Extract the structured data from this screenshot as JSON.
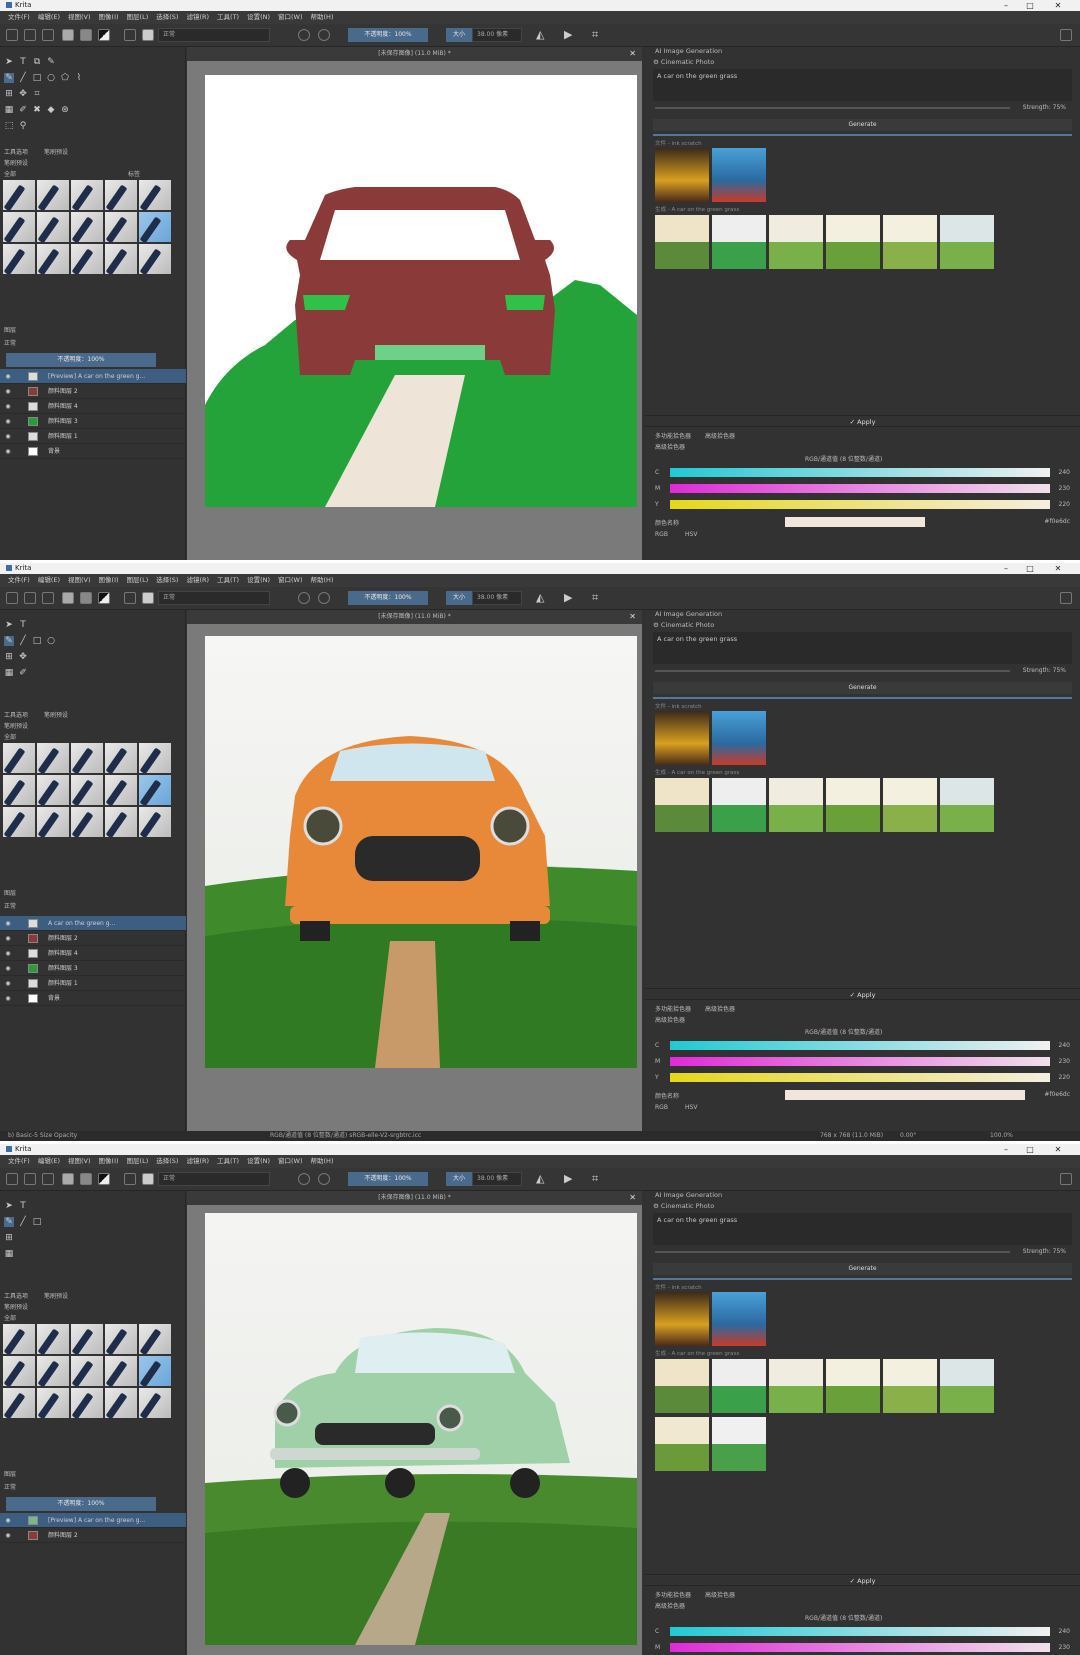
{
  "window": {
    "app_title": "Krita",
    "min": "–",
    "max": "□",
    "close": "✕"
  },
  "menu": [
    "文件(F)",
    "编辑(E)",
    "视图(V)",
    "图像(I)",
    "图层(L)",
    "选择(S)",
    "滤镜(R)",
    "工具(T)",
    "设置(N)",
    "窗口(W)",
    "帮助(H)"
  ],
  "toolbar": {
    "blend_mode": "正常",
    "opacity": "不透明度：100%",
    "size_label": "大小",
    "size_value": "38.00 像素"
  },
  "left": {
    "tab_tools": "工具选项",
    "tab_brush": "笔刷预设",
    "brush_panel": "笔刷预设",
    "filter_all": "全部",
    "tag": "标签",
    "layers_panel": "图层",
    "layer_blend": "正常",
    "layer_opacity": "不透明度：100%"
  },
  "canvas_title": "[未保存图像] (11.0 MiB) *",
  "ai": {
    "header": "AI Image Generation",
    "style": "Cinematic Photo",
    "prompt": "A car on the green grass",
    "strength": "Strength: 75%",
    "generate": "Generate",
    "history_label_1": "文件 - ink scratch",
    "history_label_2": "生成 - A car on the green grass",
    "apply": "✓ Apply"
  },
  "color": {
    "tab1": "多功能拾色器",
    "tab2": "高级拾色器",
    "panel_title": "高级拾色器",
    "model": "RGB/通道值 (8 位整数/通道)",
    "c_label": "C",
    "m_label": "M",
    "y_label": "Y",
    "c_val": "240",
    "m_val": "230",
    "y_val": "220",
    "hex_label": "颜色名称",
    "hex": "#f0e6dc",
    "rgb": "RGB",
    "hsv": "HSV"
  },
  "screens": [
    {
      "layers": [
        "[Preview] A car on the green g...",
        "颜料图层 2",
        "颜料图层 4",
        "颜料图层 3",
        "颜料图层 1",
        "背景"
      ]
    },
    {
      "layers": [
        "A car on the green g...",
        "颜料图层 2",
        "颜料图层 4",
        "颜料图层 3",
        "颜料图层 1",
        "背景"
      ]
    },
    {
      "layers": [
        "[Preview] A car on the green g...",
        "颜料图层 2"
      ]
    }
  ],
  "status": {
    "left": "b) Basic-5 Size Opacity",
    "mid": "RGB/通道值 (8 位整数/通道)  sRGB-elle-V2-srgbtrc.icc",
    "right": "768 x 768 (11.0 MiB)",
    "zoom": "100.0%",
    "angle": "0.00°"
  }
}
